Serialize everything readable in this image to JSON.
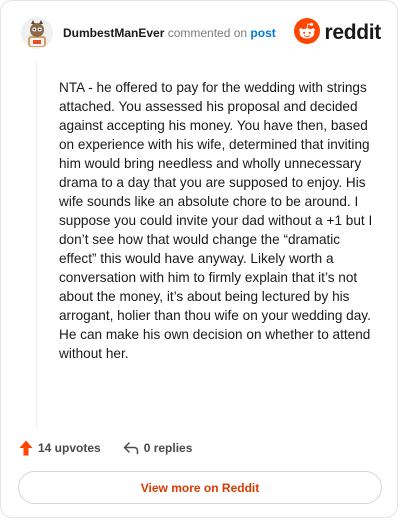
{
  "header": {
    "author": "DumbestManEver",
    "commented_text": " commented on ",
    "post_link": "post",
    "brand_icon": "reddit-snoo-icon",
    "brand_name": "reddit",
    "avatar_icon": "user-avatar-icon"
  },
  "comment": {
    "body": "NTA - he offered to pay for the wedding with strings attached. You assessed his proposal and decided against accepting his money. You have then, based on experience with his wife, determined that inviting him would bring needless and wholly unnecessary drama to a day that you are supposed to enjoy. His wife sounds like an absolute chore to be around. I suppose you could invite your dad without a +1 but I don’t see how that would change the “dramatic effect” this would have anyway. Likely worth a conversation with him to firmly explain that it’s not about the money, it’s about being lectured by his arrogant, holier than thou wife on your wedding day. He can make his own decision on whether to attend without her."
  },
  "actions": {
    "upvotes_label": "14 upvotes",
    "upvote_icon": "upvote-arrow-icon",
    "replies_label": "0 replies",
    "reply_icon": "reply-arrow-icon"
  },
  "footer": {
    "view_more_label": "View more on Reddit"
  },
  "colors": {
    "accent": "#d93a00",
    "brand": "#ff4500",
    "link": "#0079d3"
  }
}
